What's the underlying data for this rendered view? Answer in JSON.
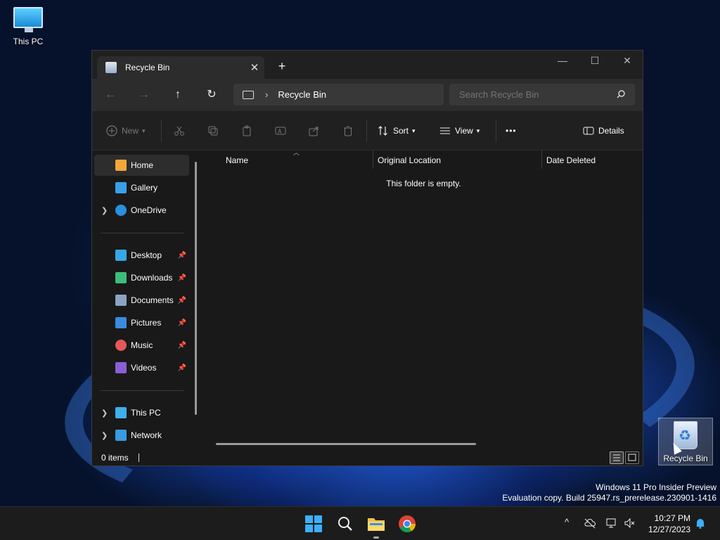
{
  "desktop": {
    "icons": [
      {
        "label": "This PC"
      },
      {
        "label": "Recycle Bin"
      }
    ],
    "watermark": {
      "line1": "Windows 11 Pro Insider Preview",
      "line2": "Evaluation copy. Build 25947.rs_prerelease.230901-1416"
    }
  },
  "window": {
    "tab_title": "Recycle Bin",
    "tab_close": "✕",
    "new_tab": "+",
    "controls": {
      "minimize": "—",
      "maximize": "☐",
      "close": "✕"
    },
    "nav": {
      "back": "←",
      "forward": "→",
      "up": "↑",
      "refresh": "↻"
    },
    "address": {
      "separator": "›",
      "location": "Recycle Bin"
    },
    "search": {
      "placeholder": "Search Recycle Bin"
    },
    "commands": {
      "new": "New",
      "sort": "Sort",
      "view": "View",
      "more": "•••",
      "details": "Details"
    },
    "sidebar": {
      "items": [
        {
          "label": "Home",
          "icon": "home-icon",
          "color": "#f2a73b"
        },
        {
          "label": "Gallery",
          "icon": "gallery-icon",
          "color": "#3aa0e8"
        },
        {
          "label": "OneDrive",
          "icon": "onedrive-icon",
          "color": "#2a8fe0"
        },
        {
          "label": "Desktop",
          "icon": "desktop-icon",
          "color": "#35a8e6"
        },
        {
          "label": "Downloads",
          "icon": "downloads-icon",
          "color": "#3cbf7a"
        },
        {
          "label": "Documents",
          "icon": "documents-icon",
          "color": "#8aa4c2"
        },
        {
          "label": "Pictures",
          "icon": "pictures-icon",
          "color": "#3b8ae0"
        },
        {
          "label": "Music",
          "icon": "music-icon",
          "color": "#e5585a"
        },
        {
          "label": "Videos",
          "icon": "videos-icon",
          "color": "#8a5fd6"
        },
        {
          "label": "This PC",
          "icon": "this-pc-icon",
          "color": "#3fb0ea"
        },
        {
          "label": "Network",
          "icon": "network-icon",
          "color": "#3a9be0"
        }
      ]
    },
    "columns": [
      "Name",
      "Original Location",
      "Date Deleted"
    ],
    "empty_message": "This folder is empty.",
    "status": {
      "count": "0 items"
    }
  },
  "taskbar": {
    "clock": {
      "time": "10:27 PM",
      "date": "12/27/2023"
    },
    "tray_chevron": "^"
  }
}
